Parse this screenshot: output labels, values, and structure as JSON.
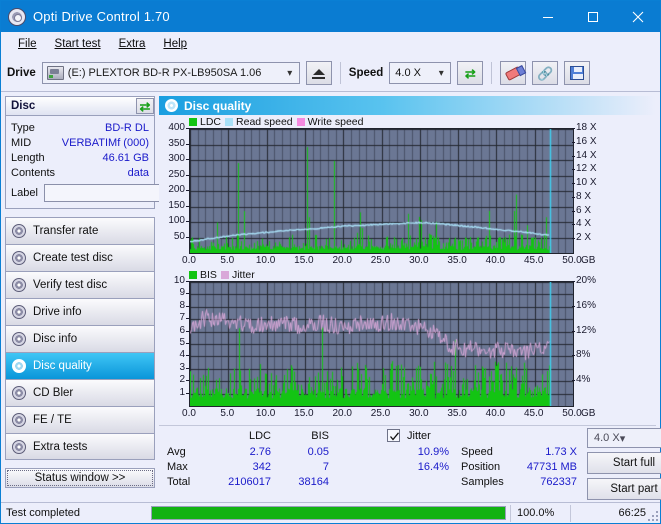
{
  "window": {
    "title": "Opti Drive Control 1.70",
    "app_icon": "disc-icon",
    "minimize": "minimize-icon",
    "maximize": "maximize-icon",
    "close": "close-icon"
  },
  "menu": [
    {
      "label": "File"
    },
    {
      "label": "Start test"
    },
    {
      "label": "Extra"
    },
    {
      "label": "Help"
    }
  ],
  "toolbar": {
    "drive_label": "Drive",
    "drive_value": "(E:)   PLEXTOR BD-R  PX-LB950SA 1.06",
    "eject_icon": "eject-icon",
    "speed_label": "Speed",
    "speed_value": "4.0 X",
    "refresh_icon": "refresh-icon",
    "erase_icon": "eraser-icon",
    "chain_icon": "chain-icon",
    "save_icon": "floppy-save-icon"
  },
  "disc_panel": {
    "title": "Disc",
    "refresh_icon": "refresh-icon",
    "rows": [
      {
        "key": "Type",
        "value": "BD-R DL"
      },
      {
        "key": "MID",
        "value": "VERBATIMf (000)"
      },
      {
        "key": "Length",
        "value": "46.61 GB"
      },
      {
        "key": "Contents",
        "value": "data"
      }
    ],
    "label_key": "Label",
    "label_value": "",
    "label_placeholder": "",
    "label_button_icon": "cd-icon"
  },
  "nav": {
    "items": [
      {
        "label": "Transfer rate",
        "active": false
      },
      {
        "label": "Create test disc",
        "active": false
      },
      {
        "label": "Verify test disc",
        "active": false
      },
      {
        "label": "Drive info",
        "active": false
      },
      {
        "label": "Disc info",
        "active": false
      },
      {
        "label": "Disc quality",
        "active": true
      },
      {
        "label": "CD Bler",
        "active": false
      },
      {
        "label": "FE / TE",
        "active": false
      },
      {
        "label": "Extra tests",
        "active": false
      }
    ],
    "status_window": "Status window >>"
  },
  "content": {
    "header_title": "Disc quality",
    "header_icon": "disc-quality-icon"
  },
  "stats": {
    "col_ldc": "LDC",
    "col_bis": "BIS",
    "rows": [
      {
        "key": "Avg",
        "ldc": "2.76",
        "bis": "0.05"
      },
      {
        "key": "Max",
        "ldc": "342",
        "bis": "7"
      },
      {
        "key": "Total",
        "ldc": "2106017",
        "bis": "38164"
      }
    ],
    "jitter_label": "Jitter",
    "jitter_checked": true,
    "jitter_avg": "10.9%",
    "jitter_max": "16.4%",
    "speed_key": "Speed",
    "speed_val": "1.73 X",
    "position_key": "Position",
    "position_val": "47731 MB",
    "samples_key": "Samples",
    "samples_val": "762337",
    "speed_select": "4.0 X",
    "start_full": "Start full",
    "start_part": "Start part"
  },
  "statusbar": {
    "text": "Test completed",
    "progress_pct": "100.0%",
    "progress_value": 100,
    "elapsed": "66:25"
  },
  "colors": {
    "accent": "#0a7cd2",
    "ldc": "#13c413",
    "bis": "#13c413",
    "read_speed": "#a9e0f7",
    "write_speed": "#f58ae0",
    "jitter": "#d9a8d9",
    "plot_bg": "#6b7794",
    "value_text": "#1a1aca",
    "progress": "#12b212"
  },
  "chart_data": [
    {
      "type": "line",
      "title": "LDC / Read speed",
      "xlabel": "GB",
      "ylabel": "LDC",
      "xlim": [
        0,
        50
      ],
      "ylim": [
        0,
        400
      ],
      "y2lim": [
        0,
        18
      ],
      "y2label": "X",
      "xticks": [
        "0.0",
        "5.0",
        "10.0",
        "15.0",
        "20.0",
        "25.0",
        "30.0",
        "35.0",
        "40.0",
        "45.0",
        "50.0"
      ],
      "yticks": [
        400,
        350,
        300,
        250,
        200,
        150,
        100,
        50
      ],
      "y2ticks": [
        "18 X",
        "16 X",
        "14 X",
        "12 X",
        "10 X",
        "8 X",
        "6 X",
        "4 X",
        "2 X"
      ],
      "xunit": "GB",
      "grid": true,
      "legend": [
        {
          "name": "LDC",
          "color": "#13c413"
        },
        {
          "name": "Read speed",
          "color": "#a9e0f7"
        },
        {
          "name": "Write speed",
          "color": "#f58ae0"
        }
      ],
      "series": [
        {
          "name": "Read speed",
          "color": "#a9e0f7",
          "kind": "line",
          "axis": "right",
          "x": [
            0,
            2,
            4,
            6,
            8,
            10,
            12,
            14,
            16,
            18,
            20,
            22,
            24,
            26,
            28,
            30,
            32,
            34,
            36,
            38,
            40,
            42,
            44,
            46,
            47
          ],
          "values": [
            1.6,
            2.0,
            2.3,
            2.6,
            2.8,
            3.0,
            3.2,
            3.4,
            3.5,
            3.7,
            3.9,
            4.0,
            4.1,
            4.2,
            4.3,
            4.4,
            4.3,
            4.1,
            3.9,
            3.7,
            3.4,
            3.2,
            3.0,
            2.7,
            2.6
          ]
        },
        {
          "name": "LDC",
          "color": "#13c413",
          "kind": "spikes",
          "axis": "left",
          "baseline": 18,
          "peak_max": 342,
          "peak_note": "dense green spikes across 0-47 GB; density and height increase after 25 GB"
        }
      ],
      "marker_line": {
        "x": 47,
        "color": "#3fd2f2"
      }
    },
    {
      "type": "line",
      "title": "BIS / Jitter",
      "xlabel": "GB",
      "ylabel": "BIS",
      "xlim": [
        0,
        50
      ],
      "ylim": [
        0,
        10
      ],
      "y2lim": [
        0,
        20
      ],
      "y2label": "%",
      "xticks": [
        "0.0",
        "5.0",
        "10.0",
        "15.0",
        "20.0",
        "25.0",
        "30.0",
        "35.0",
        "40.0",
        "45.0",
        "50.0"
      ],
      "yticks": [
        10,
        9,
        8,
        7,
        6,
        5,
        4,
        3,
        2,
        1
      ],
      "y2ticks": [
        "20%",
        "16%",
        "12%",
        "8%",
        "4%"
      ],
      "xunit": "GB",
      "grid": true,
      "legend": [
        {
          "name": "BIS",
          "color": "#13c413"
        },
        {
          "name": "Jitter",
          "color": "#d9a8d9"
        }
      ],
      "series": [
        {
          "name": "Jitter",
          "color": "#d9a8d9",
          "kind": "band",
          "axis": "right",
          "x": [
            0,
            2,
            4,
            6,
            8,
            10,
            12,
            14,
            16,
            18,
            20,
            22,
            24,
            26,
            28,
            30,
            32,
            34,
            36,
            38,
            40,
            42,
            44,
            46,
            47
          ],
          "values": [
            13.0,
            14.2,
            14.0,
            13.6,
            13.0,
            13.2,
            13.4,
            13.0,
            13.6,
            13.2,
            12.6,
            13.4,
            13.0,
            13.6,
            13.2,
            12.8,
            12.0,
            9.6,
            9.2,
            9.0,
            9.0,
            8.8,
            8.8,
            9.0,
            9.6
          ],
          "spread": 1.4
        },
        {
          "name": "BIS",
          "color": "#13c413",
          "kind": "spikes",
          "axis": "left",
          "baseline": 1.1,
          "peak_max": 7,
          "peak_note": "green BIS spikes mostly 1-3, occasional up to 7"
        }
      ],
      "marker_line": {
        "x": 47,
        "color": "#3fd2f2"
      }
    }
  ]
}
